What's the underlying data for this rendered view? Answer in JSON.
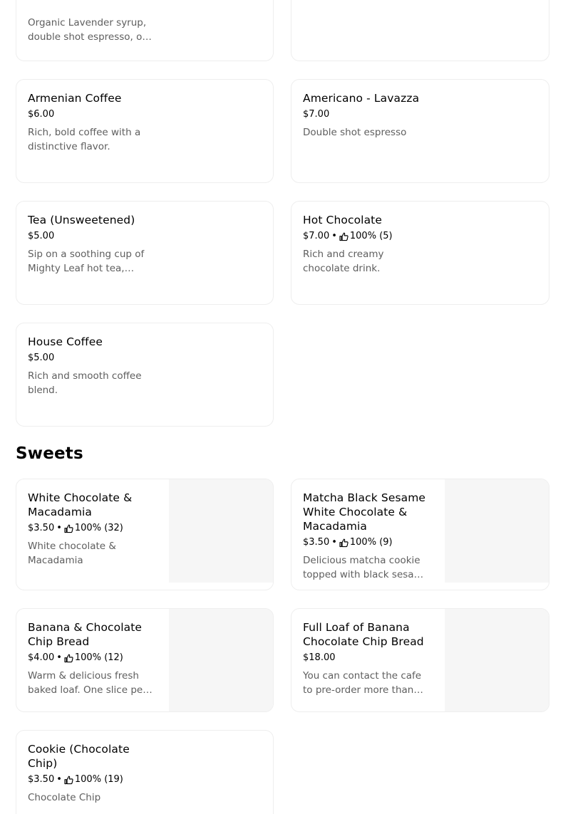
{
  "drinks": [
    {
      "name": "",
      "price": "",
      "rating": "",
      "desc": "Organic Lavender syrup, double shot espresso, oat milk"
    },
    {
      "name": "",
      "price": "",
      "rating": "",
      "desc": ""
    },
    {
      "name": "Armenian Coffee",
      "price": "$6.00",
      "rating": "",
      "desc": "Rich, bold coffee with a distinctive flavor."
    },
    {
      "name": "Americano - Lavazza",
      "price": "$7.00",
      "rating": "",
      "desc": "Double shot espresso"
    },
    {
      "name": "Tea (Unsweetened)",
      "price": "$5.00",
      "rating": "",
      "desc": "Sip on a soothing cup of Mighty Leaf hot tea, unsweetened"
    },
    {
      "name": "Hot Chocolate",
      "price": "$7.00",
      "rating": "100% (5)",
      "desc": "Rich and creamy chocolate drink."
    },
    {
      "name": "House Coffee",
      "price": "$5.00",
      "rating": "",
      "desc": "Rich and smooth coffee blend."
    }
  ],
  "sweets_section": {
    "title": "Sweets"
  },
  "sweets": [
    {
      "name": "White Chocolate & Macadamia",
      "price": "$3.50",
      "rating": "100% (32)",
      "desc": "White chocolate & Macadamia"
    },
    {
      "name": "Matcha Black Sesame White Chocolate & Macadamia",
      "price": "$3.50",
      "rating": "100% (9)",
      "desc": "Delicious matcha cookie topped with black sesame seeds"
    },
    {
      "name": "Banana & Chocolate Chip Bread",
      "price": "$4.00",
      "rating": "100% (12)",
      "desc": "Warm & delicious fresh baked loaf. One slice per order"
    },
    {
      "name": "Full Loaf of Banana Chocolate Chip Bread",
      "price": "$18.00",
      "rating": "",
      "desc": "You can contact the cafe to pre-order more than ONE loaf"
    },
    {
      "name": "Cookie (Chocolate Chip)",
      "price": "$3.50",
      "rating": "100% (19)",
      "desc": "Chocolate Chip"
    }
  ],
  "icons": {
    "rating": "thumbs-up-icon"
  },
  "colors": {
    "text": "#000000",
    "muted": "#5e5e5e",
    "border": "#eeeeee",
    "image_placeholder": "#f6f6f6"
  }
}
